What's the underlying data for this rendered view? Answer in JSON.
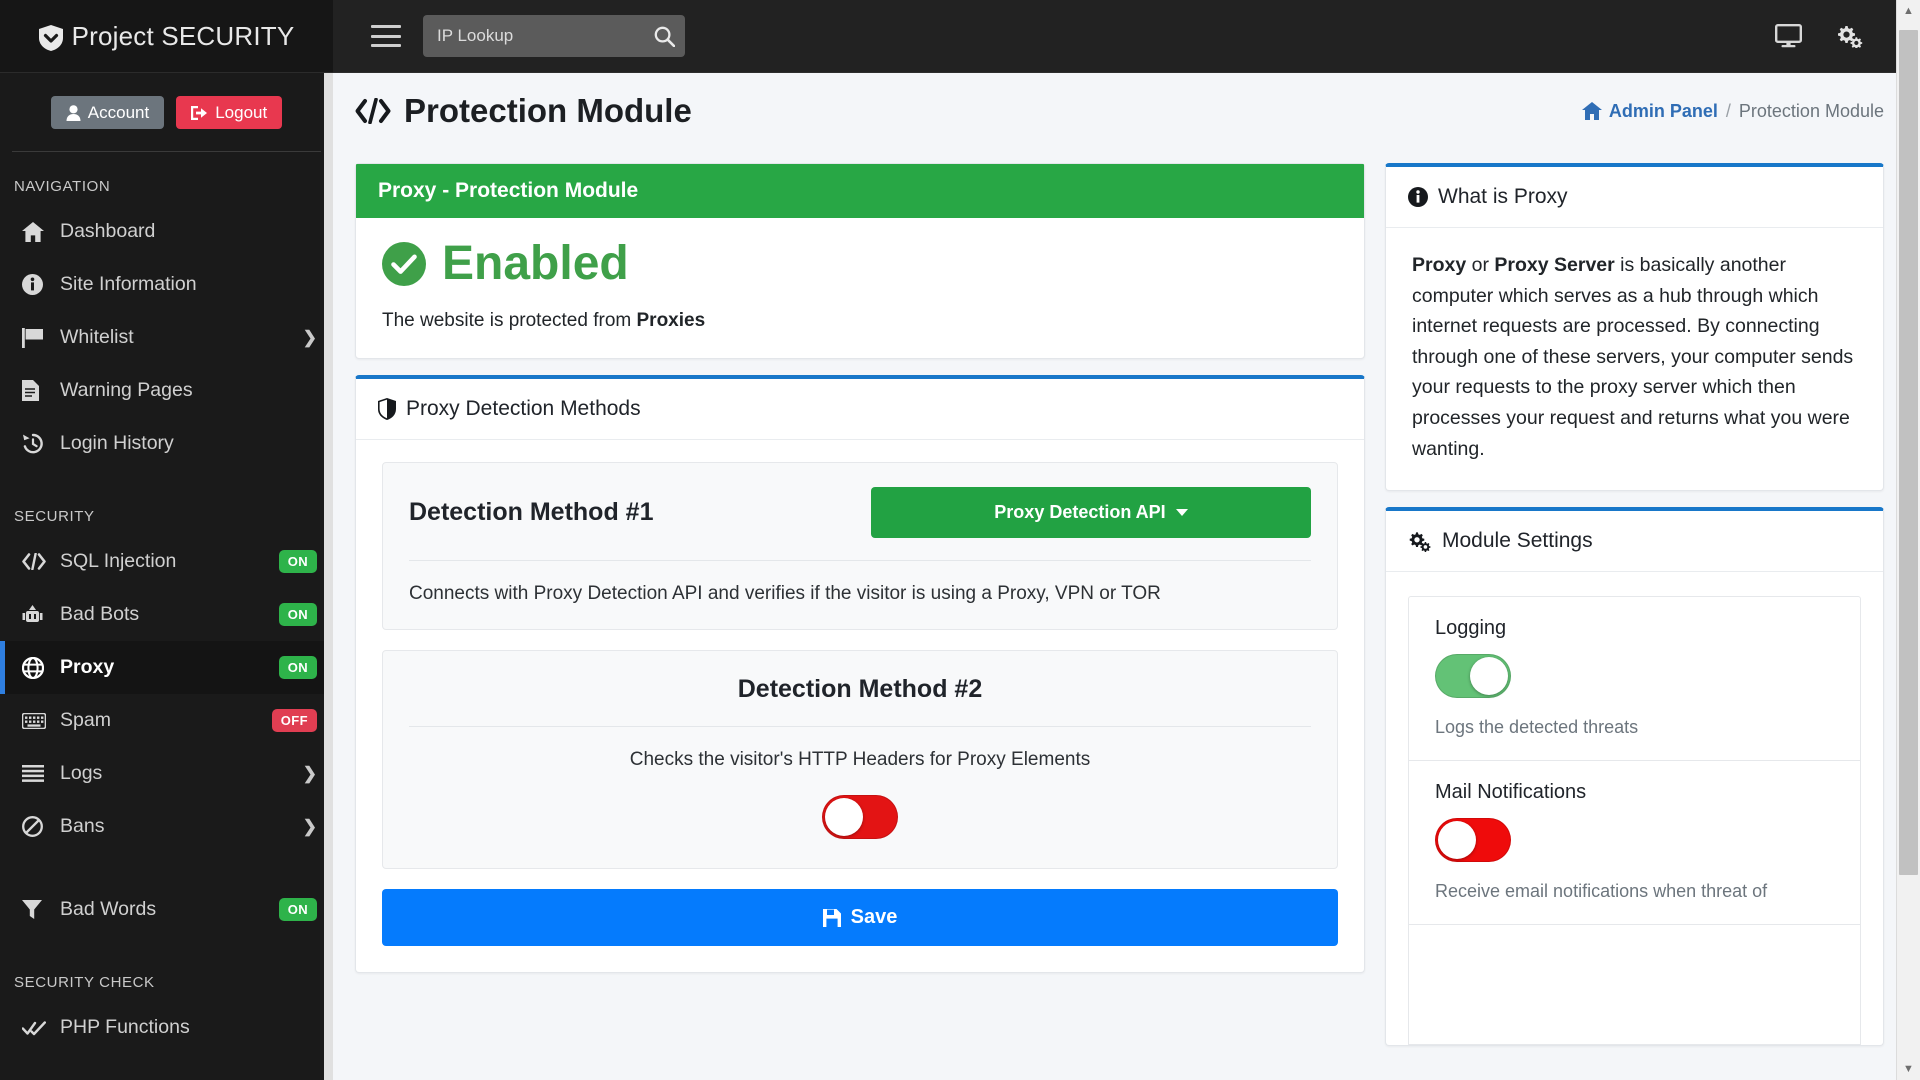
{
  "brand": {
    "name": "Project SECURITY",
    "icon": "shield-check-icon"
  },
  "sidebar": {
    "account_label": "Account",
    "logout_label": "Logout",
    "sections": [
      {
        "heading": "NAVIGATION",
        "items": [
          {
            "label": "Dashboard",
            "icon": "home-icon",
            "badge": null,
            "chevron": false,
            "active": false
          },
          {
            "label": "Site Information",
            "icon": "info-icon",
            "badge": null,
            "chevron": false,
            "active": false
          },
          {
            "label": "Whitelist",
            "icon": "flag-icon",
            "badge": null,
            "chevron": true,
            "active": false
          },
          {
            "label": "Warning Pages",
            "icon": "file-icon",
            "badge": null,
            "chevron": false,
            "active": false
          },
          {
            "label": "Login History",
            "icon": "history-icon",
            "badge": null,
            "chevron": false,
            "active": false
          }
        ]
      },
      {
        "heading": "SECURITY",
        "items": [
          {
            "label": "SQL Injection",
            "icon": "code-icon",
            "badge": "ON",
            "badge_state": "on",
            "chevron": false,
            "active": false
          },
          {
            "label": "Bad Bots",
            "icon": "robot-icon",
            "badge": "ON",
            "badge_state": "on",
            "chevron": false,
            "active": false
          },
          {
            "label": "Proxy",
            "icon": "globe-icon",
            "badge": "ON",
            "badge_state": "on",
            "chevron": false,
            "active": true
          },
          {
            "label": "Spam",
            "icon": "keyboard-icon",
            "badge": "OFF",
            "badge_state": "off",
            "chevron": false,
            "active": false
          },
          {
            "label": "Logs",
            "icon": "list-icon",
            "badge": null,
            "chevron": true,
            "active": false
          },
          {
            "label": "Bans",
            "icon": "ban-icon",
            "badge": null,
            "chevron": true,
            "active": false
          }
        ]
      },
      {
        "heading": null,
        "items": [
          {
            "label": "Bad Words",
            "icon": "filter-icon",
            "badge": "ON",
            "badge_state": "on",
            "chevron": false,
            "active": false
          }
        ]
      },
      {
        "heading": "SECURITY CHECK",
        "items": [
          {
            "label": "PHP Functions",
            "icon": "check-double-icon",
            "badge": null,
            "chevron": false,
            "active": false
          }
        ]
      }
    ]
  },
  "topbar": {
    "menu_icon": "hamburger-icon",
    "search": {
      "placeholder": "IP Lookup",
      "value": "",
      "icon": "search-icon"
    },
    "right_icons": [
      {
        "name": "desktop-icon"
      },
      {
        "name": "cogs-icon"
      }
    ]
  },
  "page": {
    "title": "Protection Module",
    "title_icon": "code-icon",
    "breadcrumb": {
      "home_icon": "home-icon",
      "home_label": "Admin Panel",
      "separator": "/",
      "current": "Protection Module"
    }
  },
  "module_card": {
    "header": "Proxy - Protection Module",
    "status_icon": "check-circle-icon",
    "status": "Enabled",
    "status_prefix": "The website is protected from ",
    "status_target": "Proxies"
  },
  "detection": {
    "header": "Proxy Detection Methods",
    "header_icon": "shield-icon",
    "methods": [
      {
        "title": "Detection Method #1",
        "control_type": "dropdown",
        "control_label": "Proxy Detection API",
        "description": "Connects with Proxy Detection API and verifies if the visitor is using a Proxy, VPN or TOR"
      },
      {
        "title": "Detection Method #2",
        "control_type": "toggle",
        "toggle_state": "off",
        "description": "Checks the visitor's HTTP Headers for Proxy Elements"
      }
    ],
    "save_label": "Save",
    "save_icon": "floppy-disk-icon"
  },
  "what_is": {
    "header": "What is Proxy",
    "header_icon": "info-circle-icon",
    "bold_1": "Proxy",
    "mid_1": " or ",
    "bold_2": "Proxy Server",
    "rest": " is basically another computer which serves as a hub through which internet requests are processed. By connecting through one of these servers, your computer sends your requests to the proxy server which then processes your request and returns what you were wanting."
  },
  "module_settings": {
    "header": "Module Settings",
    "header_icon": "cogs-icon",
    "settings": [
      {
        "label": "Logging",
        "state": "on",
        "description": "Logs the detected threats"
      },
      {
        "label": "Mail Notifications",
        "state": "off",
        "description": "Receive email notifications when threat of"
      }
    ]
  },
  "colors": {
    "accent_green": "#28a745",
    "accent_blue": "#057bfd",
    "danger_red": "#e03e52",
    "sidebar_bg": "#1a1a1a",
    "active_marker": "#2f7fe0"
  },
  "scrollbar": {
    "up_arrow": "▲",
    "down_arrow": "▼"
  }
}
